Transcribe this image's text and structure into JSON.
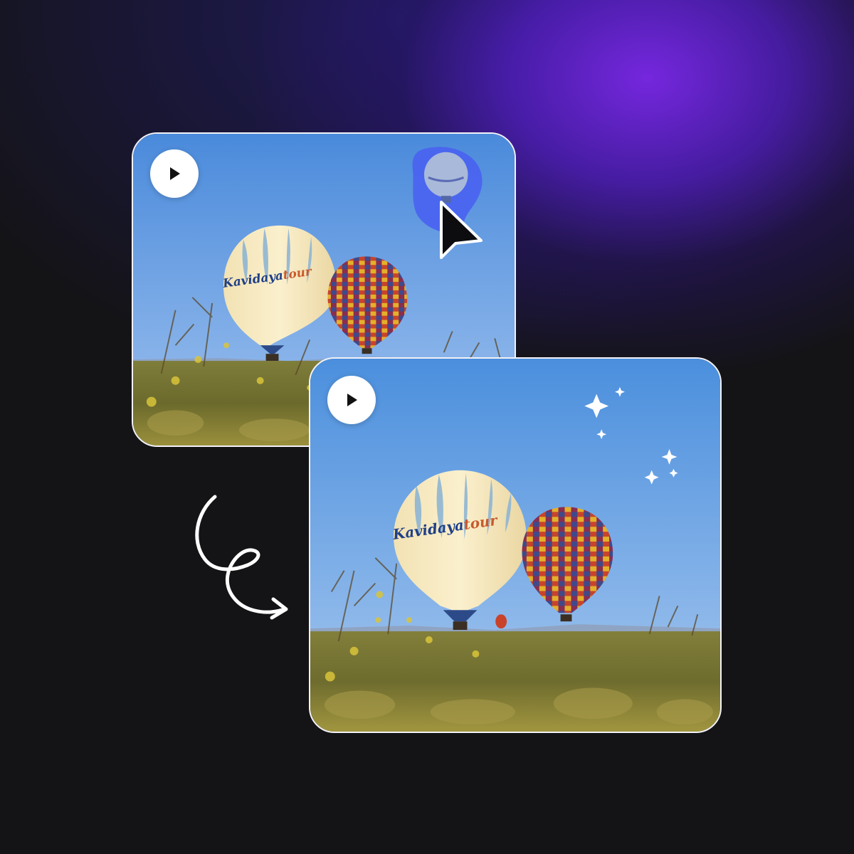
{
  "before_card": {
    "play_button": {
      "icon": "play-icon"
    },
    "balloon_lettering": {
      "left": "Kavidaya",
      "right": "tour"
    },
    "selected_object": {
      "icon": "balloon-selection"
    }
  },
  "after_card": {
    "play_button": {
      "icon": "play-icon"
    },
    "balloon_lettering": {
      "left": "Kavidaya",
      "right": "tour"
    },
    "sparkles": {
      "icon": "sparkle-icon"
    }
  },
  "cursor": {
    "icon": "mouse-pointer-icon"
  },
  "arrow": {
    "icon": "curly-arrow-icon"
  },
  "colors": {
    "background": "#141417",
    "glow": "#7a28e6",
    "selection": "#4a63f0",
    "sky_top": "#4b8fdd",
    "sky_bottom": "#a9c8ee",
    "grass": "#8c8a3a"
  }
}
